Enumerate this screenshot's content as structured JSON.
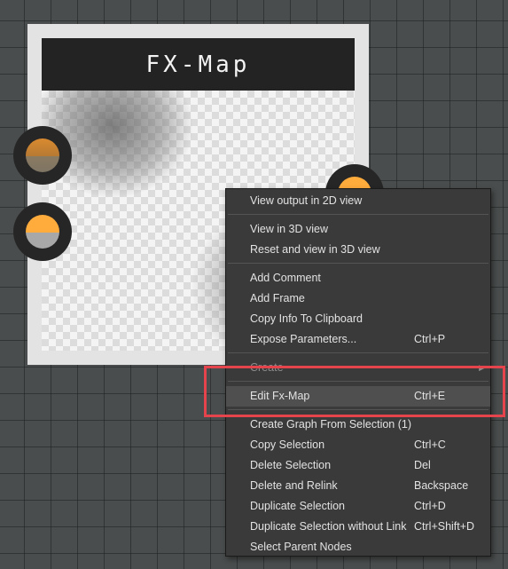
{
  "node": {
    "title": "FX-Map",
    "ports": {
      "input_1_icon": "port-circle-icon",
      "input_2_icon": "port-circle-icon",
      "output_icon": "port-circle-icon"
    },
    "colors": {
      "port_orange": "#ffac3c",
      "annotation_red": "#e5444c"
    }
  },
  "context_menu": {
    "view_output_2d": "View output in 2D view",
    "view_3d": "View in 3D view",
    "reset_view_3d": "Reset and view in 3D view",
    "add_comment": "Add Comment",
    "add_frame": "Add Frame",
    "copy_info": "Copy Info To Clipboard",
    "expose_parameters": {
      "label": "Expose Parameters...",
      "shortcut": "Ctrl+P"
    },
    "create": {
      "label": "Create",
      "submenu_icon": "chevron-right-icon"
    },
    "edit_fx_map": {
      "label": "Edit Fx-Map",
      "shortcut": "Ctrl+E"
    },
    "create_graph": "Create Graph From Selection (1)",
    "copy_selection": {
      "label": "Copy Selection",
      "shortcut": "Ctrl+C"
    },
    "delete_selection": {
      "label": "Delete Selection",
      "shortcut": "Del"
    },
    "delete_relink": {
      "label": "Delete and Relink",
      "shortcut": "Backspace"
    },
    "duplicate_selection": {
      "label": "Duplicate Selection",
      "shortcut": "Ctrl+D"
    },
    "duplicate_no_link": {
      "label": "Duplicate Selection without Link",
      "shortcut": "Ctrl+Shift+D"
    },
    "select_parent": "Select Parent Nodes"
  }
}
